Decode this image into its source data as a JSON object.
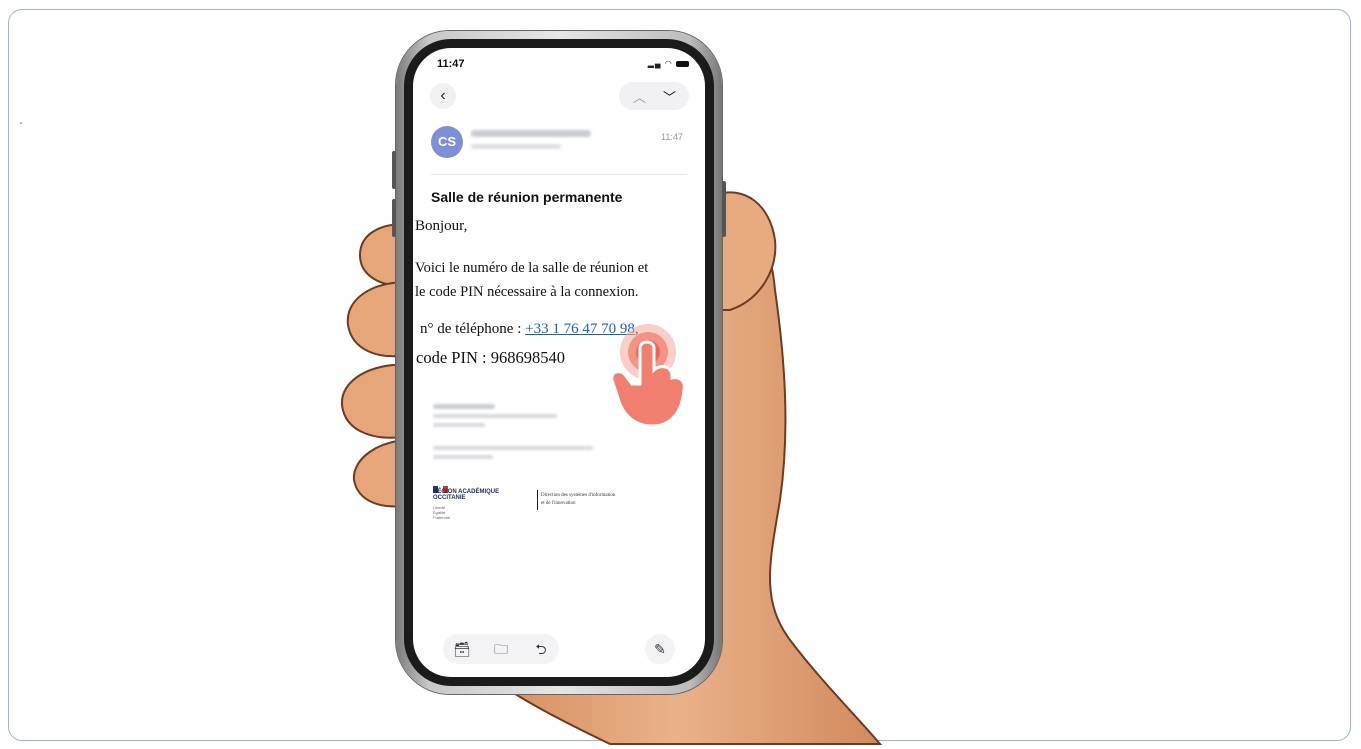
{
  "status_bar": {
    "time": "11:47"
  },
  "nav": {
    "back_icon": "chevron-left-icon",
    "up_icon": "chevron-up-icon",
    "down_icon": "chevron-down-icon"
  },
  "sender": {
    "initials": "CS",
    "time": "11:47"
  },
  "email": {
    "subject": "Salle de réunion permanente",
    "greeting": "Bonjour,",
    "line1": "Voici le numéro de la salle de réunion et",
    "line2": "le code PIN nécessaire à la connexion.",
    "phone_label": "n° de téléphone : ",
    "phone_number": "+33 1 76 47 70 98",
    "phone_suffix": ",",
    "pin_line": "code PIN : 968698540"
  },
  "signature": {
    "logo_line1": "RÉGION ACADÉMIQUE",
    "logo_line2": "OCCITANIE",
    "motto": [
      "Liberté",
      "Égalité",
      "Fraternité"
    ],
    "dept_line1": "Direction des systèmes d'information",
    "dept_line2": "et de l'innovation"
  },
  "toolbar": {
    "archive_icon": "archive-icon",
    "folder_icon": "folder-icon",
    "reply_icon": "reply-icon",
    "compose_icon": "compose-icon"
  },
  "colors": {
    "link": "#1a5fc4",
    "avatar": "#7d8fd6",
    "skin": "#e7a77a",
    "tap_indicator": "#f07f70"
  }
}
